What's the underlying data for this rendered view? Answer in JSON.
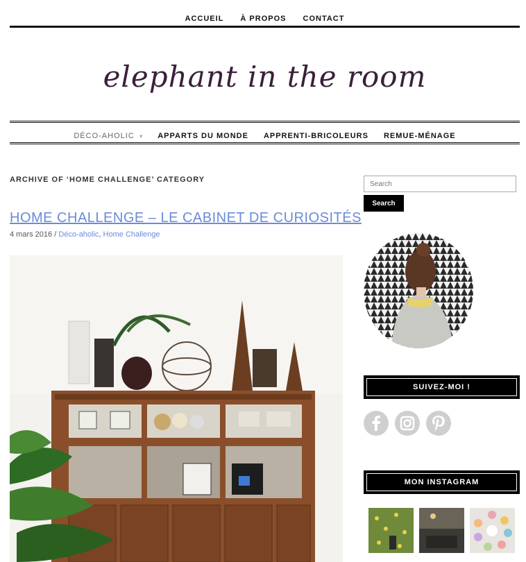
{
  "top_nav": {
    "items": [
      "ACCUEIL",
      "À PROPOS",
      "CONTACT"
    ]
  },
  "logo": {
    "text": "elephant in the room"
  },
  "main_nav": {
    "items": [
      "DÉCO-AHOLIC",
      "APPARTS DU MONDE",
      "APPRENTI-BRICOLEURS",
      "REMUE-MÉNAGE"
    ],
    "dropdown_mark": "▾"
  },
  "archive": {
    "heading": "ARCHIVE OF ‘HOME CHALLENGE’ CATEGORY"
  },
  "post": {
    "title": "HOME CHALLENGE – LE CABINET DE CURIOSITÉS",
    "date": "4 mars 2016",
    "separator": " / ",
    "categories": [
      "Déco-aholic",
      "Home Challenge"
    ]
  },
  "sidebar": {
    "search": {
      "placeholder": "Search",
      "button": "Search"
    },
    "follow_title": "SUIVEZ-MOI !",
    "social_icons": [
      "facebook-icon",
      "instagram-icon",
      "pinterest-icon"
    ],
    "instagram_title": "MON INSTAGRAM"
  },
  "colors": {
    "link": "#6a8bd8",
    "black": "#000000",
    "social_grey": "#cfcfcf"
  }
}
